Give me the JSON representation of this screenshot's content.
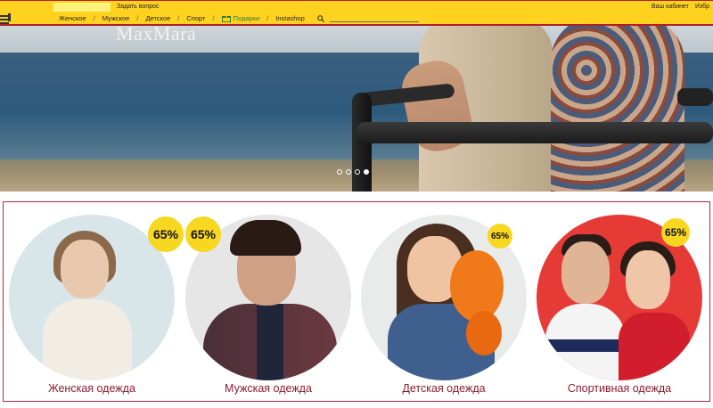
{
  "topbar": {
    "ask_question": "Задать вопрос",
    "account": "Ваш кабинет",
    "favorites": "Избр",
    "nav": {
      "women": "Женское",
      "men": "Мужское",
      "kids": "Детское",
      "sport": "Спорт",
      "gifts": "Подарки",
      "instashop": "Instashop"
    },
    "search_placeholder": ""
  },
  "hero": {
    "brand": "MaxMara",
    "slide_count": 4,
    "active_slide": 4
  },
  "categories": [
    {
      "label": "Женская одежда",
      "badge": "65%"
    },
    {
      "label": "Мужская одежда",
      "badge": "65%"
    },
    {
      "label": "Детская одежда",
      "badge": "65%"
    },
    {
      "label": "Спортивная одежда",
      "badge": "65%"
    }
  ],
  "colors": {
    "accent_yellow": "#ffd21f",
    "badge_yellow": "#f7d720",
    "label_red": "#8b1d2f",
    "border_red": "#b02a38",
    "gift_green": "#2f7d2f"
  },
  "icons": {
    "menu": "menu-icon",
    "gift": "gift-icon",
    "search": "search-icon"
  }
}
